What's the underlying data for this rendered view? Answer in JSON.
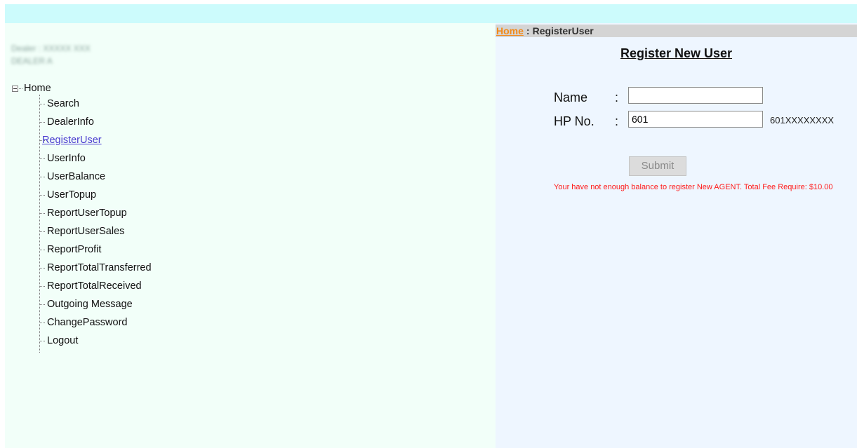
{
  "sidebar": {
    "dealer_line_1": "Dealer : XXXXX XXX",
    "dealer_line_2": "DEALER A",
    "tree": {
      "root_label": "Home",
      "items": [
        {
          "label": "Search",
          "active": false
        },
        {
          "label": "DealerInfo",
          "active": false
        },
        {
          "label": "RegisterUser",
          "active": true
        },
        {
          "label": "UserInfo",
          "active": false
        },
        {
          "label": "UserBalance",
          "active": false
        },
        {
          "label": "UserTopup",
          "active": false
        },
        {
          "label": "ReportUserTopup",
          "active": false
        },
        {
          "label": "ReportUserSales",
          "active": false
        },
        {
          "label": "ReportProfit",
          "active": false
        },
        {
          "label": "ReportTotalTransferred",
          "active": false
        },
        {
          "label": "ReportTotalReceived",
          "active": false
        },
        {
          "label": "Outgoing Message",
          "active": false
        },
        {
          "label": "ChangePassword",
          "active": false
        },
        {
          "label": "Logout",
          "active": false
        }
      ]
    }
  },
  "breadcrumb": {
    "home": "Home",
    "separator": ":",
    "current": "RegisterUser"
  },
  "form": {
    "title": "Register New User",
    "name_label": "Name",
    "name_value": "",
    "hp_label": "HP No.",
    "hp_value": "601",
    "hp_hint": "601XXXXXXXX",
    "colon": ":",
    "submit_label": "Submit",
    "error_message": "Your have not enough balance to register New AGENT. Total Fee Require: $10.00"
  },
  "colors": {
    "topbar": "#ccfbfc",
    "sidebar_bg": "#f2fff9",
    "main_bg": "#eef6ff",
    "breadcrumb_bg": "#d4d4d4",
    "home_link": "#f28a1a",
    "active_link": "#4a3ccf",
    "error": "#ff1a1a"
  }
}
